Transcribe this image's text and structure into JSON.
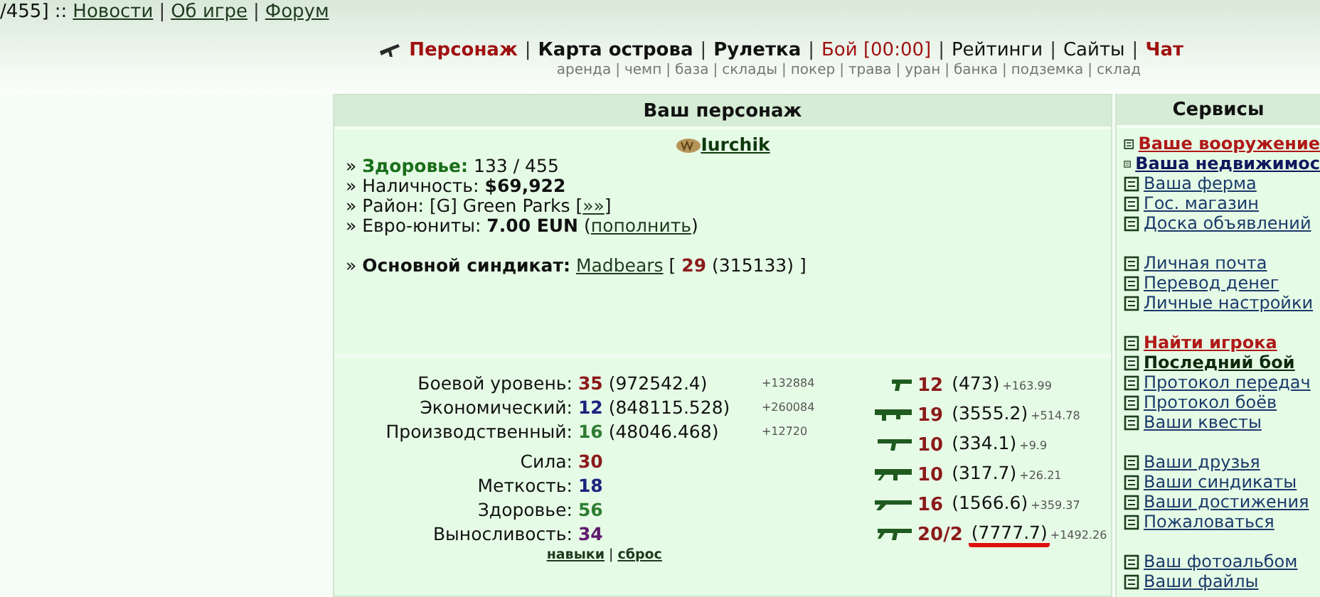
{
  "top_links": {
    "prefix": "/455] ::",
    "separator": "|",
    "links": [
      "Новости",
      "Об игре",
      "Форум"
    ]
  },
  "nav": {
    "separator": "|",
    "items": [
      {
        "label": "Персонаж",
        "kind": "red-bold",
        "icon": true
      },
      {
        "label": "Карта острова",
        "kind": "dark-bold",
        "icon": false
      },
      {
        "label": "Рулетка",
        "kind": "dark-bold",
        "icon": false
      },
      {
        "label": "Бой [00:00]",
        "kind": "red",
        "icon": false
      },
      {
        "label": "Рейтинги",
        "kind": "plain",
        "icon": false
      },
      {
        "label": "Сайты",
        "kind": "plain",
        "icon": false
      },
      {
        "label": "Чат",
        "kind": "red-bold",
        "icon": false
      }
    ]
  },
  "subnav": {
    "separator": "|",
    "items": [
      "аренда",
      "чемп",
      "база",
      "склады",
      "покер",
      "трава",
      "уран",
      "банка",
      "подземка",
      "склад"
    ]
  },
  "character": {
    "title": "Ваш персонаж",
    "name": "Iurchik",
    "bullet": "»",
    "lines": [
      [
        {
          "text": "Здоровье:",
          "kind": "green-bold"
        },
        {
          "text": "133 / 455",
          "kind": "plain"
        }
      ],
      [
        {
          "text": "Наличность:",
          "kind": "plain"
        },
        {
          "text": "$69,922",
          "kind": "bold"
        }
      ],
      [
        {
          "text": "Район: [G] Green Parks [",
          "kind": "plain"
        },
        {
          "text": "»»",
          "kind": "link"
        },
        {
          "text": "]",
          "kind": "plain"
        }
      ],
      [
        {
          "text": "Евро-юниты:",
          "kind": "plain"
        },
        {
          "text": "7.00 EUN",
          "kind": "bold"
        },
        {
          "text": "(",
          "kind": "plain"
        },
        {
          "text": "пополнить",
          "kind": "link"
        },
        {
          "text": ")",
          "kind": "plain"
        }
      ]
    ],
    "syndicate_line": [
      {
        "text": "Основной синдикат:",
        "kind": "bold"
      },
      {
        "text": "Madbears",
        "kind": "link"
      },
      {
        "text": "[",
        "kind": "plain"
      },
      {
        "text": "29",
        "kind": "red-bold"
      },
      {
        "text": "(315133) ]",
        "kind": "plain"
      }
    ]
  },
  "levels": [
    {
      "label": "Боевой уровень:",
      "level": "35",
      "points": "(972542.4)",
      "gain": "+132884",
      "color": "#8b1a1a"
    },
    {
      "label": "Экономический:",
      "level": "12",
      "points": "(848115.528)",
      "gain": "+260084",
      "color": "#1a237e"
    },
    {
      "label": "Производственный:",
      "level": "16",
      "points": "(48046.468)",
      "gain": "+12720",
      "color": "#2e7d32"
    }
  ],
  "attributes": [
    {
      "label": "Сила:",
      "value": "30",
      "color": "#8b1a1a"
    },
    {
      "label": "Меткость:",
      "value": "18",
      "color": "#1a237e"
    },
    {
      "label": "Здоровье:",
      "value": "56",
      "color": "#2e7d32"
    },
    {
      "label": "Выносливость:",
      "value": "34",
      "color": "#5e1a6e"
    }
  ],
  "skill_links": {
    "separator": "|",
    "items": [
      "навыки",
      "сброс"
    ]
  },
  "weapons": [
    {
      "kind": "pistol",
      "level": "12",
      "points": "(473)",
      "gain": "+163.99",
      "highlighted": false
    },
    {
      "kind": "launcher",
      "level": "19",
      "points": "(3555.2)",
      "gain": "+514.78",
      "highlighted": false
    },
    {
      "kind": "smg",
      "level": "10",
      "points": "(334.1)",
      "gain": "+9.9",
      "highlighted": false
    },
    {
      "kind": "machinegun",
      "level": "10",
      "points": "(317.7)",
      "gain": "+26.21",
      "highlighted": false
    },
    {
      "kind": "shotgun",
      "level": "16",
      "points": "(1566.6)",
      "gain": "+359.37",
      "highlighted": false
    },
    {
      "kind": "rifle",
      "level": "20/2",
      "points": "(7777.7)",
      "gain": "+1492.26",
      "highlighted": true
    }
  ],
  "services": {
    "title": "Сервисы",
    "groups": [
      [
        {
          "label": "Ваше вооружение",
          "kind": "red-bold"
        },
        {
          "label": "Ваша недвижимос",
          "kind": "navy-bold"
        },
        {
          "label": "Ваша ферма",
          "kind": "plain"
        },
        {
          "label": "Гос. магазин",
          "kind": "plain"
        },
        {
          "label": "Доска объявлений",
          "kind": "plain"
        }
      ],
      [
        {
          "label": "Личная почта",
          "kind": "plain"
        },
        {
          "label": "Перевод денег",
          "kind": "plain"
        },
        {
          "label": "Личные настройки",
          "kind": "plain"
        }
      ],
      [
        {
          "label": "Найти игрока",
          "kind": "red-bold"
        },
        {
          "label": "Последний бой",
          "kind": "dark-bold"
        },
        {
          "label": "Протокол передач",
          "kind": "plain"
        },
        {
          "label": "Протокол боёв",
          "kind": "plain"
        },
        {
          "label": "Ваши квесты",
          "kind": "plain"
        }
      ],
      [
        {
          "label": "Ваши друзья",
          "kind": "plain"
        },
        {
          "label": "Ваши синдикаты",
          "kind": "plain"
        },
        {
          "label": "Ваши достижения",
          "kind": "plain"
        },
        {
          "label": "Пожаловаться",
          "kind": "plain"
        }
      ],
      [
        {
          "label": "Ваш фотоальбом",
          "kind": "plain"
        },
        {
          "label": "Ваши файлы",
          "kind": "plain"
        }
      ]
    ]
  }
}
